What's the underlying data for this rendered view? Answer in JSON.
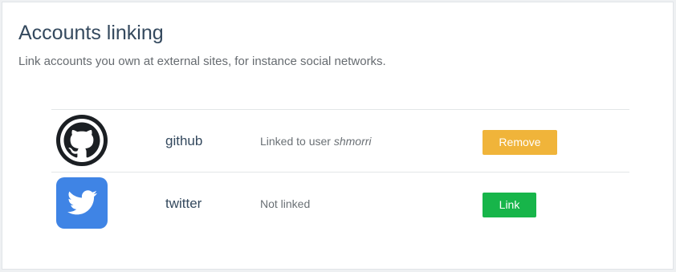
{
  "page": {
    "title": "Accounts linking",
    "description": "Link accounts you own at external sites, for instance social networks."
  },
  "accounts": [
    {
      "icon": "github-icon",
      "name": "github",
      "status_prefix": "Linked to user ",
      "status_user": "shmorri",
      "action_label": "Remove",
      "action_color": "#f0b43a"
    },
    {
      "icon": "twitter-icon",
      "name": "twitter",
      "status_prefix": "Not linked",
      "status_user": "",
      "action_label": "Link",
      "action_color": "#17b54a"
    }
  ],
  "colors": {
    "heading": "#34495e",
    "github_dark": "#1b1f23",
    "twitter_blue": "#3f84e5"
  }
}
